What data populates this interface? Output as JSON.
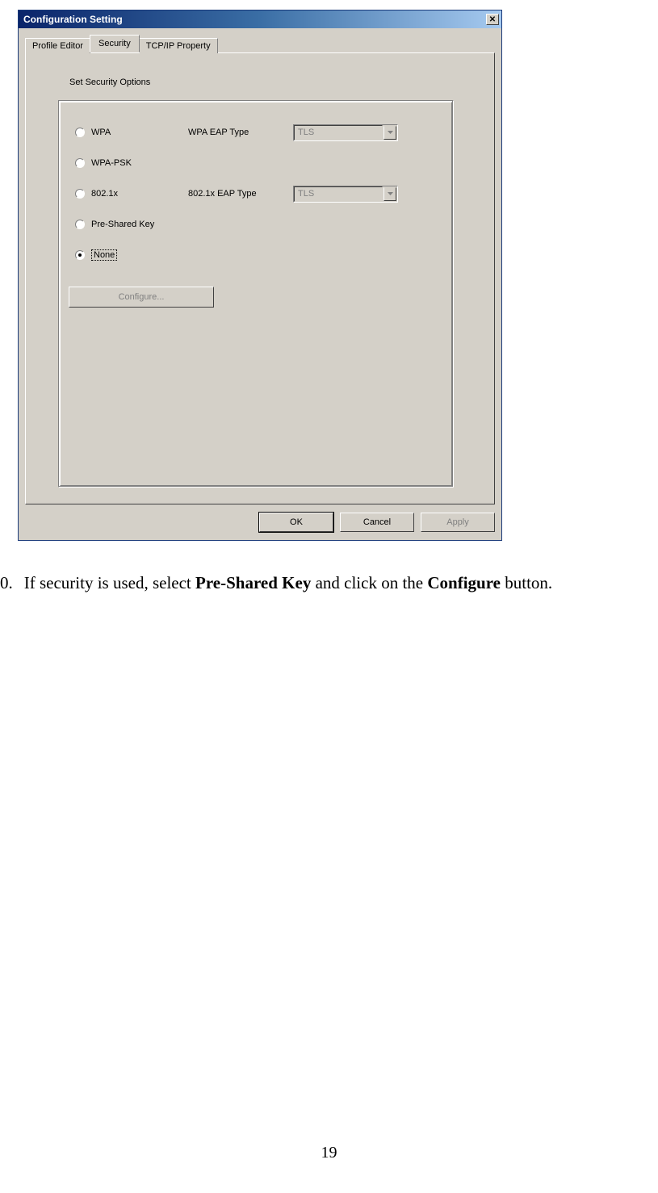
{
  "dialog": {
    "title": "Configuration Setting",
    "tabs": {
      "profile_editor": "Profile Editor",
      "security": "Security",
      "tcpip": "TCP/IP Property"
    },
    "group_label": "Set Security Options",
    "radios": {
      "wpa": "WPA",
      "wpa_psk": "WPA-PSK",
      "dot1x": "802.1x",
      "psk": "Pre-Shared Key",
      "none": "None"
    },
    "wpa_eap_label": "WPA EAP Type",
    "dot1x_eap_label": "802.1x EAP Type",
    "wpa_eap_value": "TLS",
    "dot1x_eap_value": "TLS",
    "configure_label": "Configure...",
    "buttons": {
      "ok": "OK",
      "cancel": "Cancel",
      "apply": "Apply"
    }
  },
  "instruction": {
    "number": "0.",
    "pre": "If security is used, select ",
    "bold1": "Pre-Shared Key",
    "mid": " and click on the ",
    "bold2": "Configure",
    "post": " button."
  },
  "page_number": "19"
}
